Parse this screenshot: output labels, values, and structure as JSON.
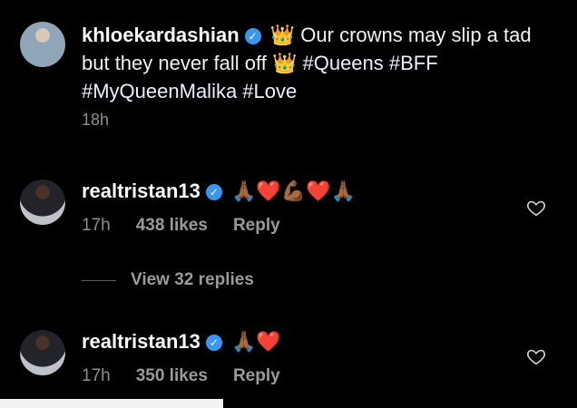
{
  "post": {
    "username": "khloekardashian",
    "verified_icon": "verified-badge-icon",
    "caption_parts": {
      "crown1": "👑",
      "text1": " Our crowns may slip a tad but they never fall off ",
      "crown2": "👑",
      "hashtags": "#Queens #BFF #MyQueenMalika #Love"
    },
    "time": "18h"
  },
  "comments": [
    {
      "username": "realtristan13",
      "text": "🙏🏾❤️💪🏾❤️🙏🏾",
      "time": "17h",
      "likes": "438 likes",
      "reply": "Reply",
      "like_icon": "heart-icon"
    },
    {
      "username": "realtristan13",
      "text": "🙏🏾❤️",
      "time": "17h",
      "likes": "350 likes",
      "reply": "Reply",
      "like_icon": "heart-icon"
    }
  ],
  "view_replies": "View 32 replies",
  "colors": {
    "background": "#000000",
    "text": "#f5f5f5",
    "muted": "#8e8e8e",
    "verified": "#3897f0"
  }
}
